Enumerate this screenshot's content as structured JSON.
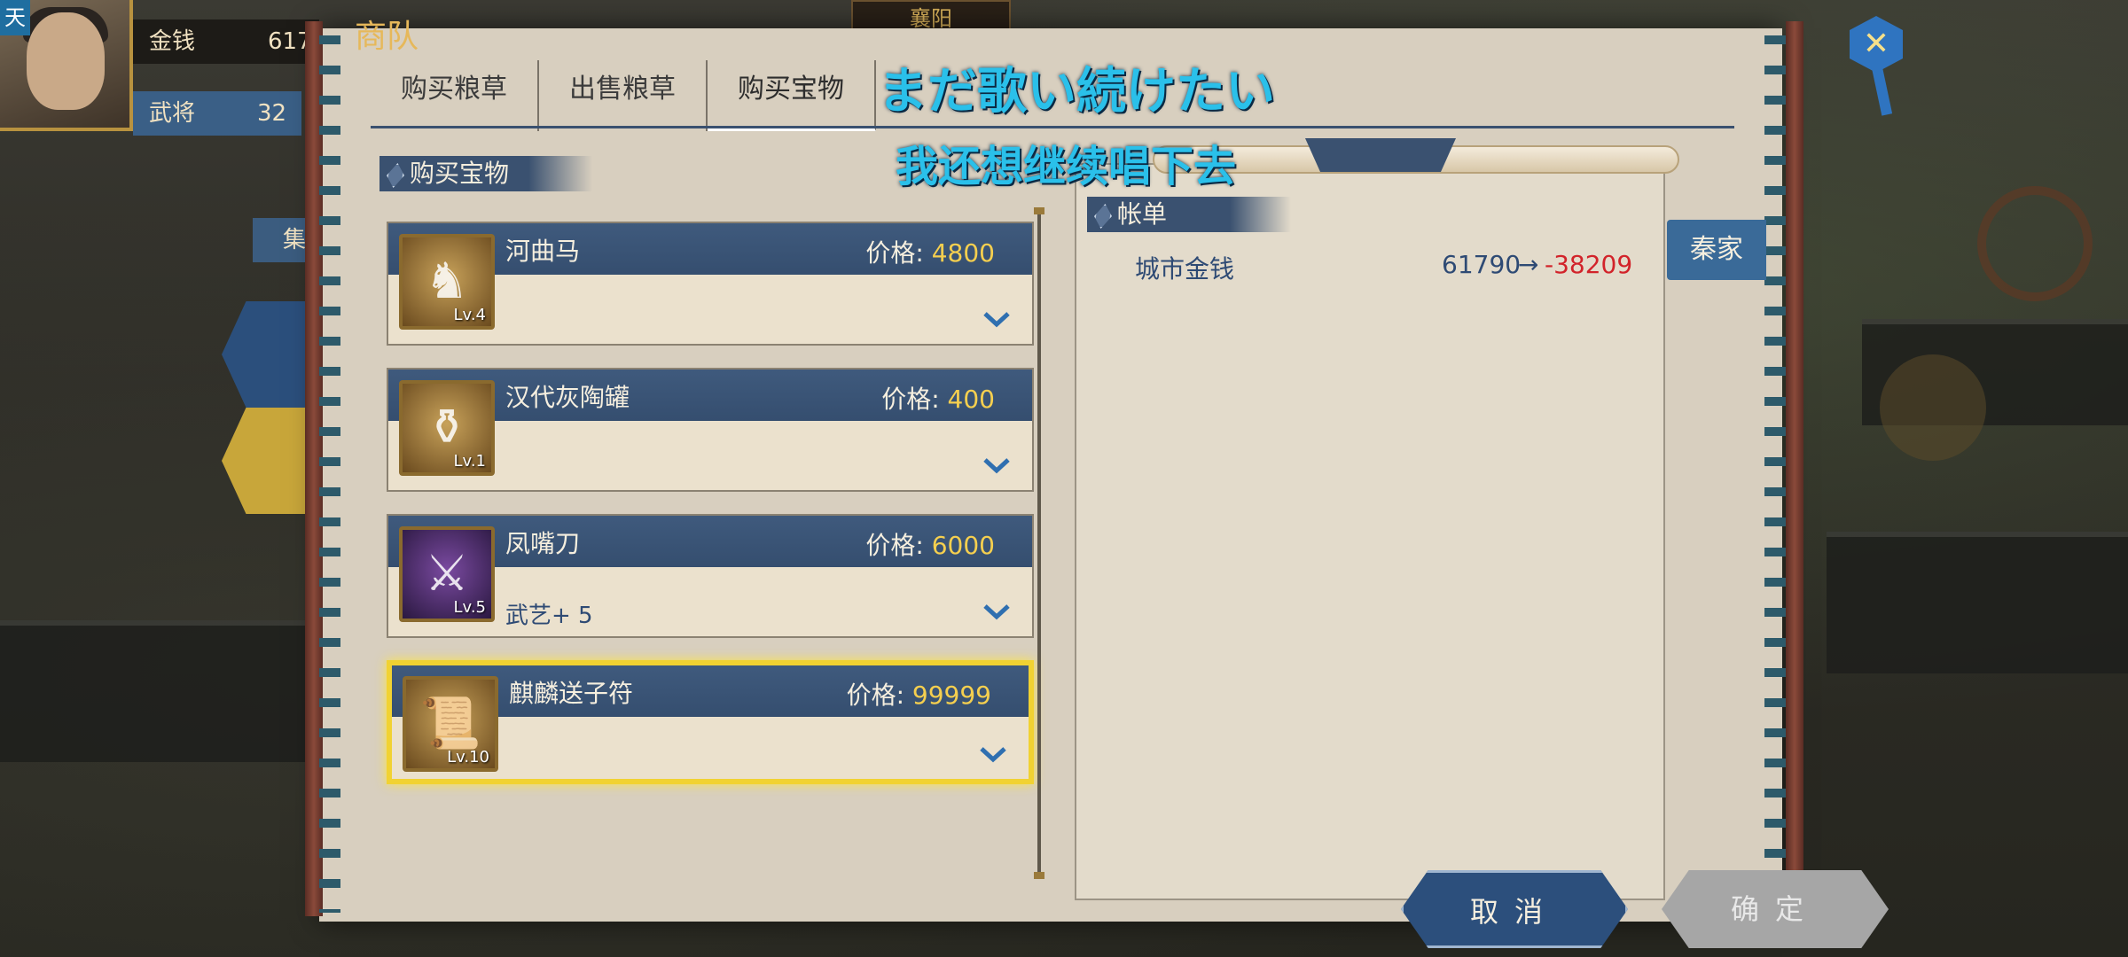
{
  "hud": {
    "portrait_tag": "天",
    "money_label": "金钱",
    "money_value": "617",
    "generals_label": "武将",
    "generals_value": "32",
    "city_name": "襄阳",
    "side_tab_label": "集"
  },
  "dialog": {
    "title": "商队",
    "tabs": [
      {
        "label": "购买粮草"
      },
      {
        "label": "出售粮草"
      },
      {
        "label": "购买宝物"
      }
    ],
    "active_tab": "购买宝物"
  },
  "subtitles": {
    "jp": "まだ歌い続けたい",
    "cn": "我还想继续唱下去"
  },
  "list_section": {
    "title": "购买宝物",
    "price_label": "价格:",
    "items": [
      {
        "name": "河曲马",
        "price": "4800",
        "level": "Lv.4",
        "stat": "",
        "icon": "horse-icon"
      },
      {
        "name": "汉代灰陶罐",
        "price": "400",
        "level": "Lv.1",
        "stat": "",
        "icon": "jar-icon"
      },
      {
        "name": "凤嘴刀",
        "price": "6000",
        "level": "Lv.5",
        "stat": "武艺+ 5",
        "icon": "blade-icon"
      },
      {
        "name": "麒麟送子符",
        "price": "99999",
        "level": "Lv.10",
        "stat": "",
        "icon": "talisman-icon",
        "selected": true
      }
    ]
  },
  "bill": {
    "title": "帐单",
    "row_label": "城市金钱",
    "from": "61790",
    "arrow": "→",
    "to": "-38209"
  },
  "right_tab": "秦家",
  "buttons": {
    "cancel": "取消",
    "confirm": "确定"
  },
  "colors": {
    "panel": "#d8cfbf",
    "header_blue": "#3a5170",
    "price_gold": "#f5cf4f",
    "negative_red": "#d2232a",
    "subtitle_cyan": "#2ac0ea",
    "selected_yellow": "#f1d232"
  }
}
